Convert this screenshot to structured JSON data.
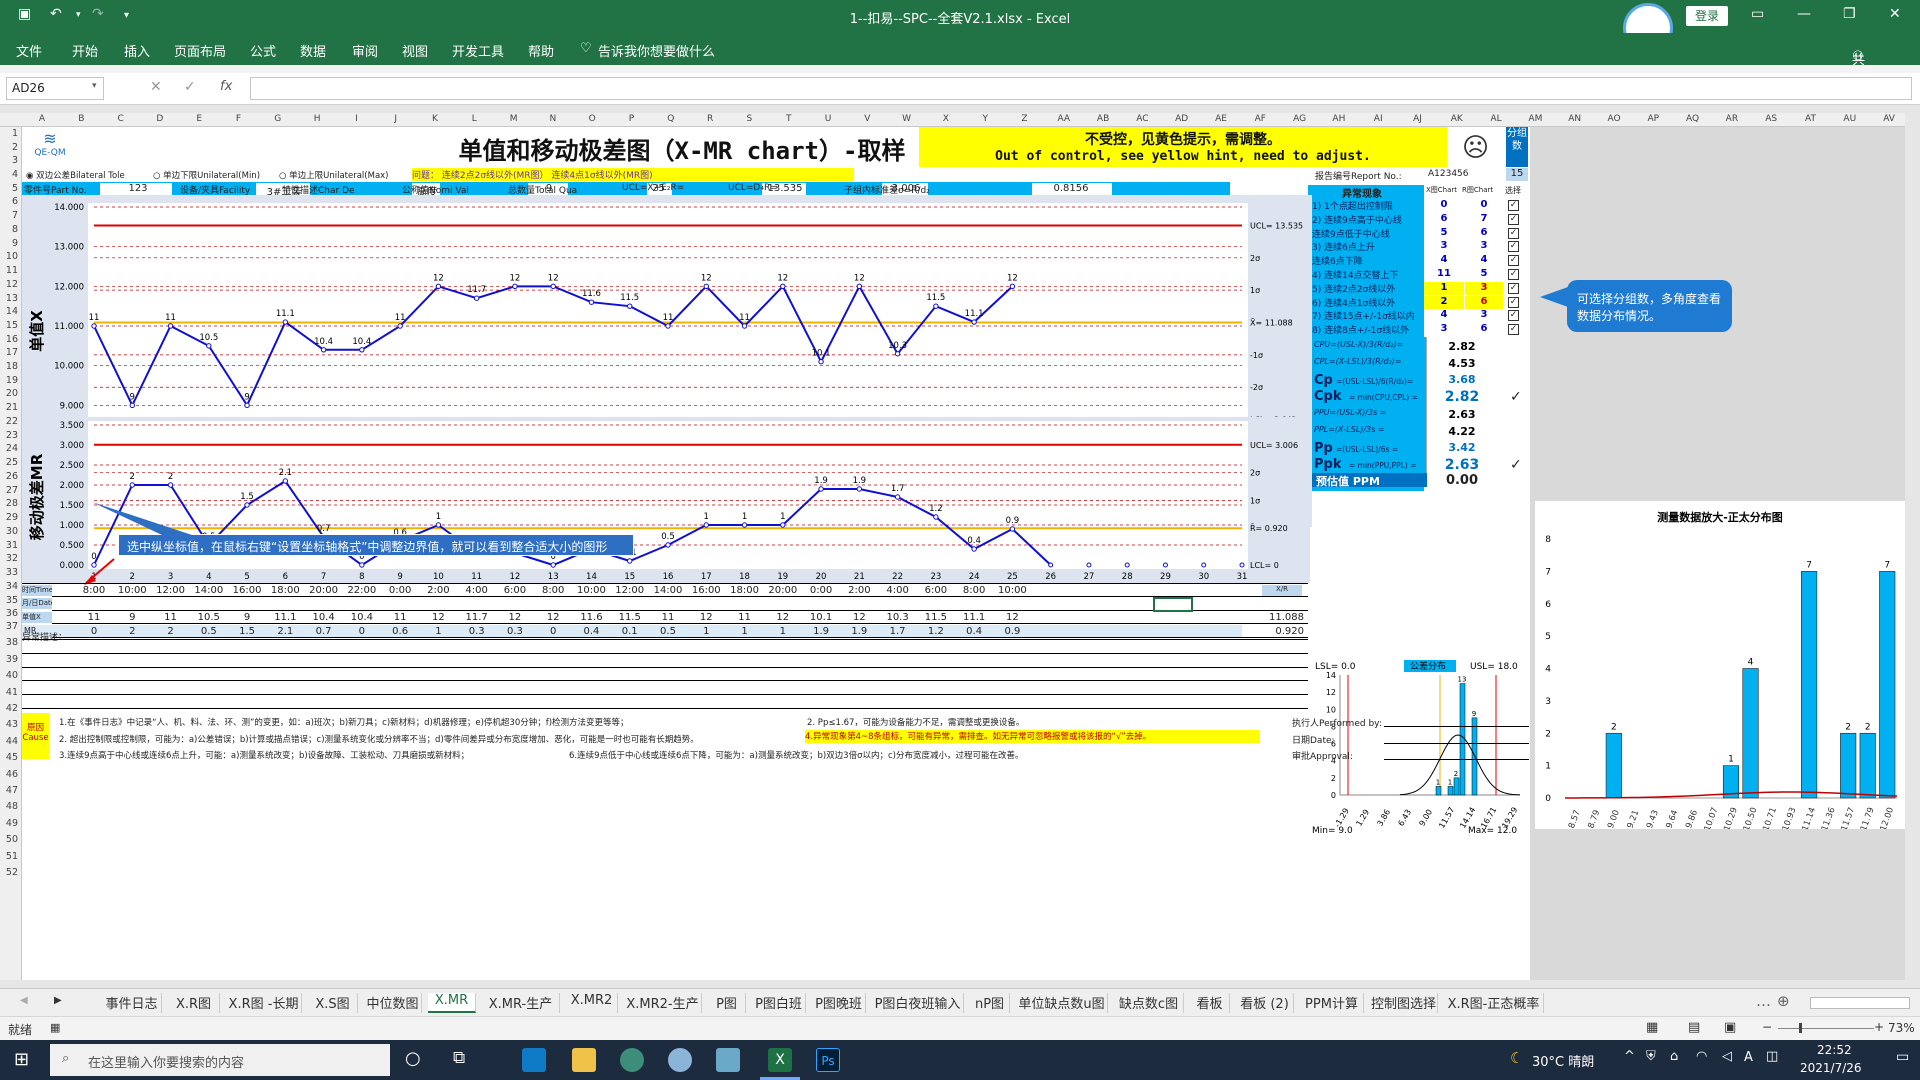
{
  "window": {
    "title": "1--扣易--SPC--全套V2.1.xlsx  -  Excel",
    "login": "登录",
    "logo_text": "QE-QM",
    "share": "共享"
  },
  "ribbon_tabs": [
    "文件",
    "开始",
    "插入",
    "页面布局",
    "公式",
    "数据",
    "审阅",
    "视图",
    "开发工具",
    "帮助"
  ],
  "tell_me": "告诉我你想要做什么",
  "formula_bar": {
    "name_box": "AD26",
    "fx": "fx",
    "formula": ""
  },
  "columns": [
    "A",
    "B",
    "C",
    "D",
    "E",
    "F",
    "G",
    "H",
    "I",
    "J",
    "K",
    "L",
    "M",
    "N",
    "O",
    "P",
    "Q",
    "R",
    "S",
    "T",
    "U",
    "V",
    "W",
    "X",
    "Y",
    "Z",
    "AA",
    "AB",
    "AC",
    "AD",
    "AE",
    "AF",
    "AG",
    "AH",
    "AI",
    "AJ",
    "AK",
    "AL",
    "AM",
    "AN",
    "AO",
    "AP",
    "AQ",
    "AR",
    "AS",
    "AT",
    "AU",
    "AV"
  ],
  "rows": [
    "1",
    "2",
    "3",
    "4",
    "5",
    "6",
    "7",
    "8",
    "9",
    "10",
    "11",
    "12",
    "13",
    "14",
    "15",
    "16",
    "17",
    "18",
    "19",
    "20",
    "21",
    "22",
    "23",
    "24",
    "25",
    "26",
    "27",
    "28",
    "29",
    "30",
    "31",
    "32",
    "33",
    "34",
    "35",
    "36",
    "37",
    "38",
    "39",
    "40",
    "41",
    "42",
    "43",
    "44",
    "45",
    "46",
    "47",
    "48",
    "49",
    "50",
    "51",
    "52"
  ],
  "sheet": {
    "main_title": "单值和移动极差图（X-MR chart）-取样",
    "ooc_line1": "不受控，见黄色提示，需调整。",
    "ooc_line2": "Out of control, see yellow hint, need to adjust.",
    "face": "☹",
    "group_label": "分组数",
    "group_value": "15",
    "tolerance_opts": [
      "双边公差Bilateral Tole",
      "单边下限Unilateral(Min)",
      "单边上限Unilateral(Max)"
    ],
    "rule_hint": "问题：   连续2点2σ线以外(MR图）   连续4点1σ线以外(MR图)",
    "report_no_label": "报告编号Report No.:",
    "report_no": "A123456",
    "info": {
      "part_no_label": "零件号Part No.",
      "part_no": "123",
      "part_name_label": "零件名称Part Na",
      "part_name": "ABC",
      "process_label": "工序Process",
      "process": "OP01",
      "facility_label": "设备/夹具Facility",
      "facility": "3#工装",
      "gage_label": "量具名Gage Name",
      "gage": "高度规",
      "batch_label": "批号Batch Numb",
      "batch": "123456",
      "char_label": "特性描述Char De",
      "char": "高度",
      "char_no_label": "特性编号Char No",
      "char_no": "006#",
      "freq_label": "抽样频率Frequen",
      "freq": "连续",
      "nominal_label": "公称值Nomi Val",
      "nominal": "9",
      "upper_label": "上公差Upper To",
      "upper": "9",
      "lower_label": "下公差Lower To",
      "lower": "-9",
      "total_label": "总数量Total Qua",
      "total": "25",
      "usl_label": "上规格限USL",
      "usl": "18",
      "lsl_label": "下规格限LSL",
      "lsl": "0",
      "ucl_x_label": "UCL=X̄+E₂R̄=",
      "ucl_x": "13.535",
      "xbar_label": "X̄=",
      "xbar": "11.088",
      "lcl_x_label": "LCL=X̄-E₂R̄=",
      "lcl_x": "8.641",
      "ucl_r_label": "UCL=D₄R̄=",
      "ucl_r": "3.006",
      "rbar_label": "R̄=",
      "rbar": "0.920",
      "lcl_r_label": "LCL=D₃R̄=",
      "lcl_r": "0",
      "sigma_label": "子组内标准差σ=R̄/d₂",
      "sigma": "0.8156",
      "stdev_label": "总变差标准差s",
      "stdev": "0.8767",
      "subgroup_label": "子组大小Subgroup size",
      "subgroup": "1"
    },
    "abnormal": {
      "header": "异常现象",
      "col_x": "X图Chart",
      "col_r": "R图Chart",
      "col_sel": "选择",
      "items": [
        {
          "label": "1) 1个点超出控制限",
          "x": "0",
          "r": "0",
          "hl": false
        },
        {
          "label": "2) 连续9点高于中心线",
          "x": "6",
          "r": "7",
          "hl": false
        },
        {
          "label": "   连续9点低于中心线",
          "x": "5",
          "r": "6",
          "hl": false
        },
        {
          "label": "3) 连续6点上升",
          "x": "3",
          "r": "3",
          "hl": false
        },
        {
          "label": "   连续6点下降",
          "x": "4",
          "r": "4",
          "hl": false
        },
        {
          "label": "4) 连续14点交替上下",
          "x": "11",
          "r": "5",
          "hl": false
        },
        {
          "label": "5) 连续2点2σ线以外",
          "x": "1",
          "r": "3",
          "hl": true
        },
        {
          "label": "6) 连续4点1σ线以外",
          "x": "2",
          "r": "6",
          "hl": true
        },
        {
          "label": "7) 连续15点+/-1σ线以内",
          "x": "4",
          "r": "3",
          "hl": false
        },
        {
          "label": "8) 连续8点+/-1σ线以外",
          "x": "3",
          "r": "6",
          "hl": false
        }
      ],
      "cpu_label": "CPU=(USL-X̄)/3(R̄/d₂)=",
      "cpu": "2.82",
      "cpl_label": "CPL=(X̄-LSL)/3(R̄/d₂)=",
      "cpl": "4.53",
      "cp_label": "Cp",
      "cp_formula": "=(USL-LSL)/6(R̄/d₂)=",
      "cp": "3.68",
      "cpk_label": "Cpk",
      "cpk_formula": "= min(CPU,CPL) =",
      "cpk": "2.82",
      "ppu_label": "PPU=(USL-X̄)/3s =",
      "ppu": "2.63",
      "ppl_label": "PPL=(X̄-LSL)/3s =",
      "ppl": "4.22",
      "pp_label": "Pp",
      "pp_formula": "=(USL-LSL)/6s =",
      "pp": "3.42",
      "ppk_label": "Ppk",
      "ppk_formula": "= min(PPU,PPL) =",
      "ppk": "2.63",
      "ppm_label": "预估值 PPM",
      "ppm": "0.00"
    },
    "hist_small": {
      "lsl": "LSL= 0.0",
      "usl": "USL= 18.0",
      "tol": "公差分布",
      "min": "Min= 9.0",
      "max": "Max= 12.0",
      "x_labels": [
        "-1.29",
        "1.29",
        "3.86",
        "6.43",
        "9.00",
        "11.57",
        "14.14",
        "16.71",
        "19.29"
      ]
    },
    "timeline": {
      "time_label": "时间Time",
      "date_label": "月/日Date",
      "x_label": "单值X",
      "mr_label": "MR",
      "times": [
        "8:00",
        "10:00",
        "12:00",
        "14:00",
        "16:00",
        "18:00",
        "20:00",
        "22:00",
        "0:00",
        "2:00",
        "4:00",
        "6:00",
        "8:00",
        "10:00",
        "12:00",
        "14:00",
        "16:00",
        "18:00",
        "20:00",
        "0:00",
        "2:00",
        "4:00",
        "6:00",
        "8:00",
        "10:00"
      ],
      "xbar_label": "X̄/R̄",
      "xbar_val": "11.088",
      "rbar_val": "0.920"
    },
    "remarks_label": "异常描述：",
    "cause_label": "原因Cause",
    "causes": [
      "1.在《事件日志》中记录“人、机、料、法、环、测”的变更，如：a)班次；b)新刀具；c)新材料；d)机器修理；e)停机超30分钟；f)检测方法变更等等；",
      "2. Pp≤1.67，可能为设备能力不足，需调整或更换设备。",
      "2. 超出控制限或控制限，可能为：a)公差错误；b)计算或描点错误；c)测量系统变化或分辨率不当；d)零件间差异或分布宽度增加、恶化，可能是一时也可能有长期趋势。",
      "4.异常现象第4~8条组标，可能有异常，需排查。如无异常可忽略报警或将该报的“√”去掉。",
      "3.连续9点高于中心线或连续6点上升，可能：a)测量系统改变；b)设备故障、工装松动、刀具磨损或新材料；",
      "6.连续9点低于中心线或连续6点下降，可能为：a)测量系统改变；b)双边3倍σ以内；c)分布宽度减小，过程可能在改善。"
    ],
    "performed_label": "执行人Performed by:",
    "date_label": "日期Date:",
    "approval_label": "审批Approval:"
  },
  "callouts": {
    "right": "可选择分组数，多角度查看数据分布情况。",
    "left": "选中纵坐标值，在鼠标右键“设置坐标轴格式”中调整边界值，就可以看到整合适大小的图形"
  },
  "chart_data": [
    {
      "type": "line",
      "title": "",
      "ylabel": "单值X",
      "x": [
        1,
        2,
        3,
        4,
        5,
        6,
        7,
        8,
        9,
        10,
        11,
        12,
        13,
        14,
        15,
        16,
        17,
        18,
        19,
        20,
        21,
        22,
        23,
        24,
        25
      ],
      "series": [
        {
          "name": "",
          "values": [
            11,
            9,
            11,
            10.5,
            9,
            11.1,
            10.4,
            10.4,
            11,
            12,
            11.7,
            12,
            12,
            11.6,
            11.5,
            11,
            12,
            11,
            12,
            10.1,
            12,
            10.3,
            11.5,
            11.1,
            12
          ]
        }
      ],
      "ucl": 13.535,
      "cl": 11.088,
      "lcl": 8.641,
      "line_labels": [
        "UCL= 13.535",
        "2σ",
        "1σ",
        "X̄= 11.088",
        "-1σ",
        "-2σ",
        "LCL= 8.641"
      ],
      "ylim": [
        8,
        14
      ],
      "y_ticks": [
        "14.000",
        "13.000",
        "12.000",
        "11.000",
        "10.000",
        "9.000",
        "8.000"
      ],
      "x_ticks": [
        "1",
        "2",
        "3",
        "4",
        "5",
        "6",
        "7",
        "8",
        "9",
        "10",
        "11",
        "12",
        "13",
        "14",
        "15",
        "16",
        "17",
        "18",
        "19",
        "20",
        "21",
        "22",
        "23",
        "24",
        "25",
        "26",
        "27",
        "28",
        "29",
        "30",
        "31"
      ]
    },
    {
      "type": "line",
      "title": "",
      "ylabel": "移动极差MR",
      "x": [
        1,
        2,
        3,
        4,
        5,
        6,
        7,
        8,
        9,
        10,
        11,
        12,
        13,
        14,
        15,
        16,
        17,
        18,
        19,
        20,
        21,
        22,
        23,
        24,
        25
      ],
      "series": [
        {
          "name": "",
          "values": [
            0,
            2,
            2,
            0.5,
            1.5,
            2.1,
            0.7,
            0,
            0.6,
            1,
            0.3,
            0.3,
            0,
            0.4,
            0.1,
            0.5,
            1,
            1,
            1,
            1.9,
            1.9,
            1.7,
            1.2,
            0.4,
            0.9
          ]
        }
      ],
      "ucl": 3.006,
      "cl": 0.92,
      "lcl": 0,
      "line_labels": [
        "UCL= 3.006",
        "2σ",
        "1σ",
        "R̄= 0.920",
        "LCL= 0"
      ],
      "ylim": [
        0,
        3.5
      ],
      "y_ticks": [
        "3.500",
        "3.000",
        "2.500",
        "2.000",
        "1.500",
        "1.000",
        "0.500",
        "0.000"
      ]
    },
    {
      "type": "bar",
      "title": "测量数据放大-正太分布图",
      "categories": [
        "8.57",
        "8.79",
        "9.00",
        "9.21",
        "9.43",
        "9.64",
        "9.86",
        "10.07",
        "10.29",
        "10.50",
        "10.71",
        "10.93",
        "11.14",
        "11.36",
        "11.57",
        "11.79",
        "12.00"
      ],
      "values": [
        0,
        0,
        2,
        0,
        0,
        0,
        0,
        0,
        1,
        4,
        0,
        0,
        7,
        0,
        2,
        2,
        7
      ],
      "ylim": [
        0,
        8
      ],
      "y_ticks": [
        "8",
        "7",
        "6",
        "5",
        "4",
        "3",
        "2",
        "1",
        "0"
      ]
    },
    {
      "type": "bar",
      "title": "",
      "categories": [
        "9.0",
        "9.5",
        "10.0",
        "10.5",
        "11.0",
        "11.5",
        "12.0"
      ],
      "values": [
        1,
        0,
        1,
        2,
        13,
        0,
        9
      ],
      "ylim": [
        0,
        14
      ],
      "y_ticks": [
        "14",
        "12",
        "10",
        "8",
        "6",
        "4",
        "2",
        "0"
      ]
    }
  ],
  "sheet_tabs": [
    "事件日志",
    "X.R图",
    "X.R图 -长期",
    "X.S图",
    "中位数图",
    "X.MR",
    "X.MR-生产",
    "X.MR2",
    "X.MR2-生产",
    "P图",
    "P图白班",
    "P图晚班",
    "P图白夜班输入",
    "nP图",
    "单位缺点数u图",
    "缺点数c图",
    "看板",
    "看板 (2)",
    "PPM计算",
    "控制图选择",
    "X.R图-正态概率"
  ],
  "active_tab": "X.MR",
  "status": {
    "ready": "就绪",
    "zoom": "73%"
  },
  "taskbar": {
    "search": "在这里输入你要搜索的内容",
    "weather": "30°C 晴朗",
    "time": "22:52",
    "date": "2021/7/26",
    "ime": "A"
  }
}
